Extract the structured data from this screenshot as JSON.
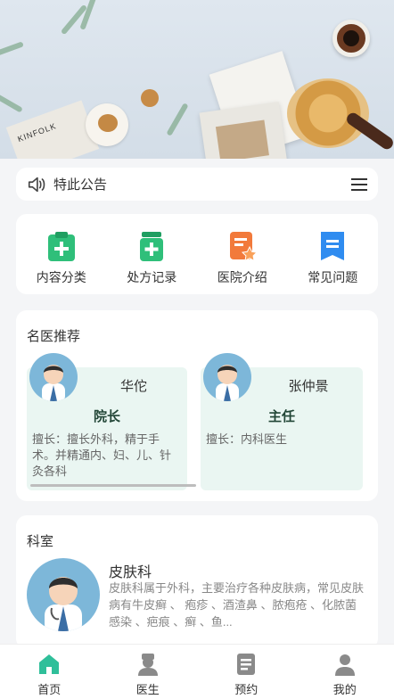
{
  "notice": {
    "text": "特此公告",
    "icon": "speaker-icon",
    "menu_icon": "menu-icon"
  },
  "quick": [
    {
      "label": "内容分类",
      "icon": "clipboard-plus-icon",
      "color": "#2fbf7a"
    },
    {
      "label": "处方记录",
      "icon": "medicine-bottle-icon",
      "color": "#2fbf7a"
    },
    {
      "label": "医院介绍",
      "icon": "document-star-icon",
      "color": "#f27a3b"
    },
    {
      "label": "常见问题",
      "icon": "bookmark-list-icon",
      "color": "#2f8cf0"
    }
  ],
  "doctors": {
    "title": "名医推荐",
    "items": [
      {
        "name": "华佗",
        "role": "院长",
        "desc": "擅长：擅长外科，精于手术。并精通内、妇、儿、针灸各科"
      },
      {
        "name": "张仲景",
        "role": "主任",
        "desc": "擅长：内科医生"
      }
    ]
  },
  "dept": {
    "title": "科室",
    "name": "皮肤科",
    "desc": "皮肤科属于外科，主要治疗各种皮肤病，常见皮肤病有牛皮癣 、 疱疹 、酒渣鼻 、脓疱疮 、化脓菌感染 、疤痕 、癣 、鱼..."
  },
  "tabs": [
    {
      "label": "首页",
      "icon": "home-icon",
      "active": true
    },
    {
      "label": "医生",
      "icon": "doctor-icon",
      "active": false
    },
    {
      "label": "预约",
      "icon": "appointment-icon",
      "active": false
    },
    {
      "label": "我的",
      "icon": "user-icon",
      "active": false
    }
  ],
  "colors": {
    "accent_green": "#2fbf7a",
    "card_bg": "#eaf6f2",
    "role_text": "#214536"
  }
}
